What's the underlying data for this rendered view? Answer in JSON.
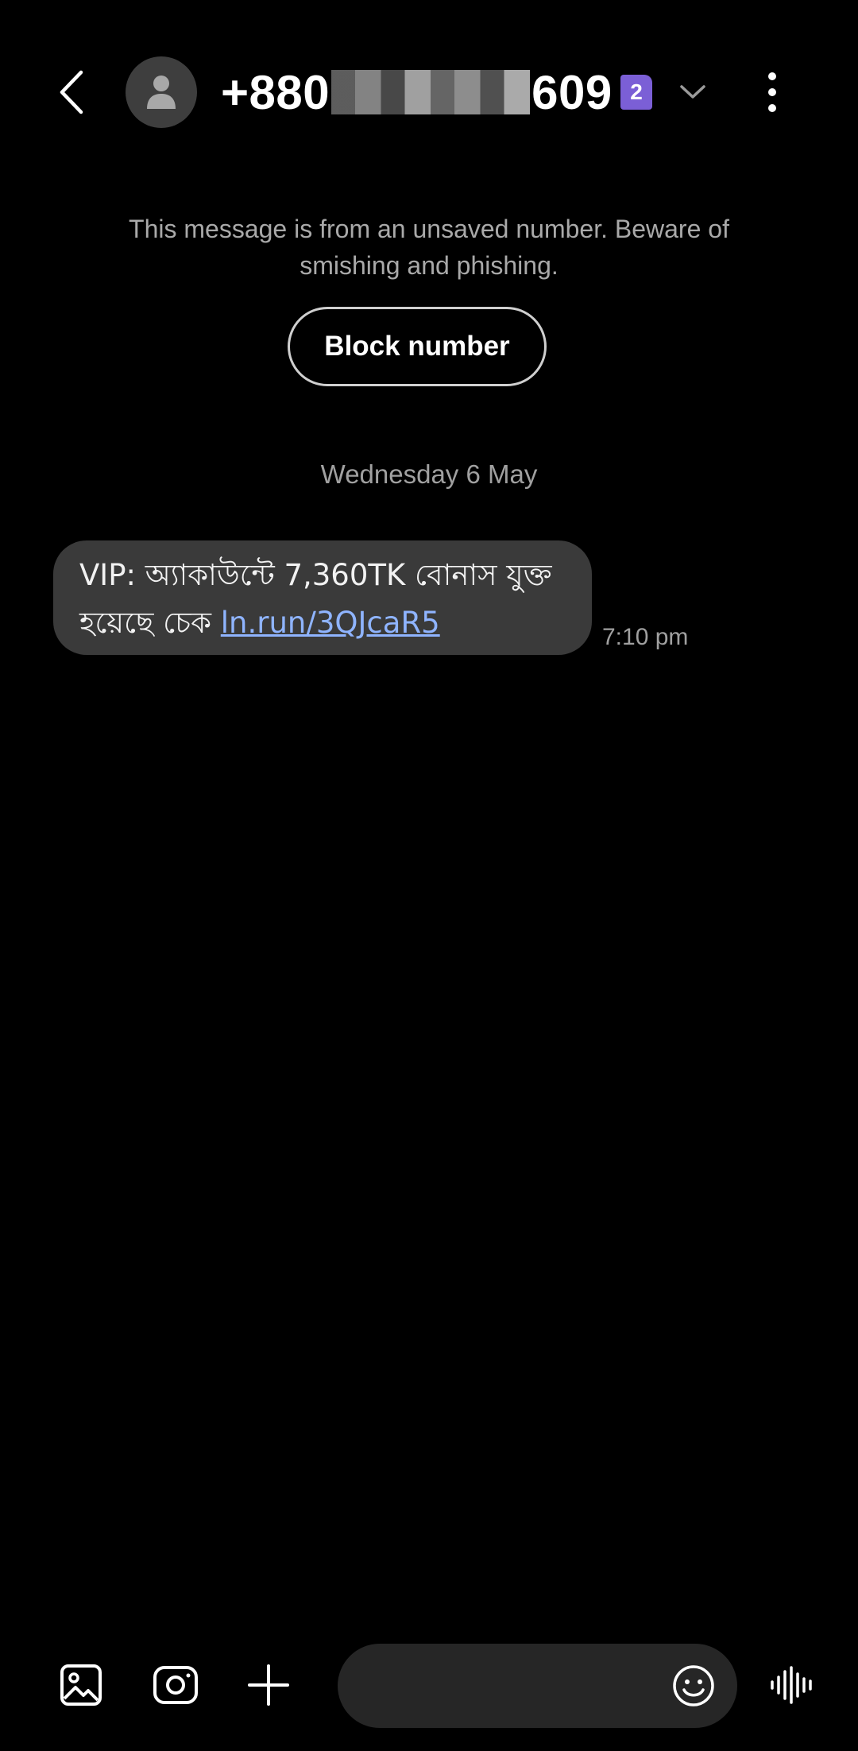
{
  "header": {
    "contact_prefix": "+880",
    "contact_suffix": "609",
    "sim_badge": "2"
  },
  "icons": {
    "back": "chevron-left-icon",
    "avatar": "person-icon",
    "dropdown": "chevron-down-icon",
    "more": "more-vertical-icon",
    "gallery": "image-icon",
    "camera": "camera-icon",
    "attach": "plus-icon",
    "emoji": "emoji-icon",
    "voice": "voice-wave-icon"
  },
  "warning": {
    "text": "This message is from an unsaved number. Beware of smishing and phishing.",
    "block_label": "Block number"
  },
  "conversation": {
    "date": "Wednesday 6 May",
    "messages": [
      {
        "text": "VIP: অ্যাকাউন্টে 7,360TK বোনাস যুক্ত হয়েছে চেক ",
        "link": "ln.run/3QJcaR5",
        "time": "7:10 pm"
      }
    ]
  },
  "composer": {
    "placeholder": ""
  },
  "colors": {
    "background": "#000000",
    "bubble": "#3a3a3a",
    "link": "#8fb4ff",
    "sim_badge": "#7b5fd6",
    "composer": "#262626",
    "muted_text": "#a0a0a0"
  }
}
